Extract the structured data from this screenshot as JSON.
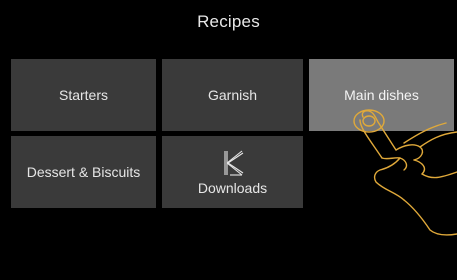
{
  "header": {
    "title": "Recipes"
  },
  "tiles": [
    {
      "label": "Starters",
      "active": false
    },
    {
      "label": "Garnish",
      "active": false
    },
    {
      "label": "Main dishes",
      "active": true
    },
    {
      "label": "Dessert & Biscuits",
      "active": false
    },
    {
      "label": "Downloads",
      "icon": "k-logo-icon",
      "active": false
    }
  ],
  "overlay": {
    "icon": "tap-hand-gesture-icon",
    "color": "#e0a93a"
  },
  "colors": {
    "background": "#000000",
    "tile": "#3a3a3a",
    "tile_active": "#7a7a7a",
    "text": "#e6e6e6"
  }
}
